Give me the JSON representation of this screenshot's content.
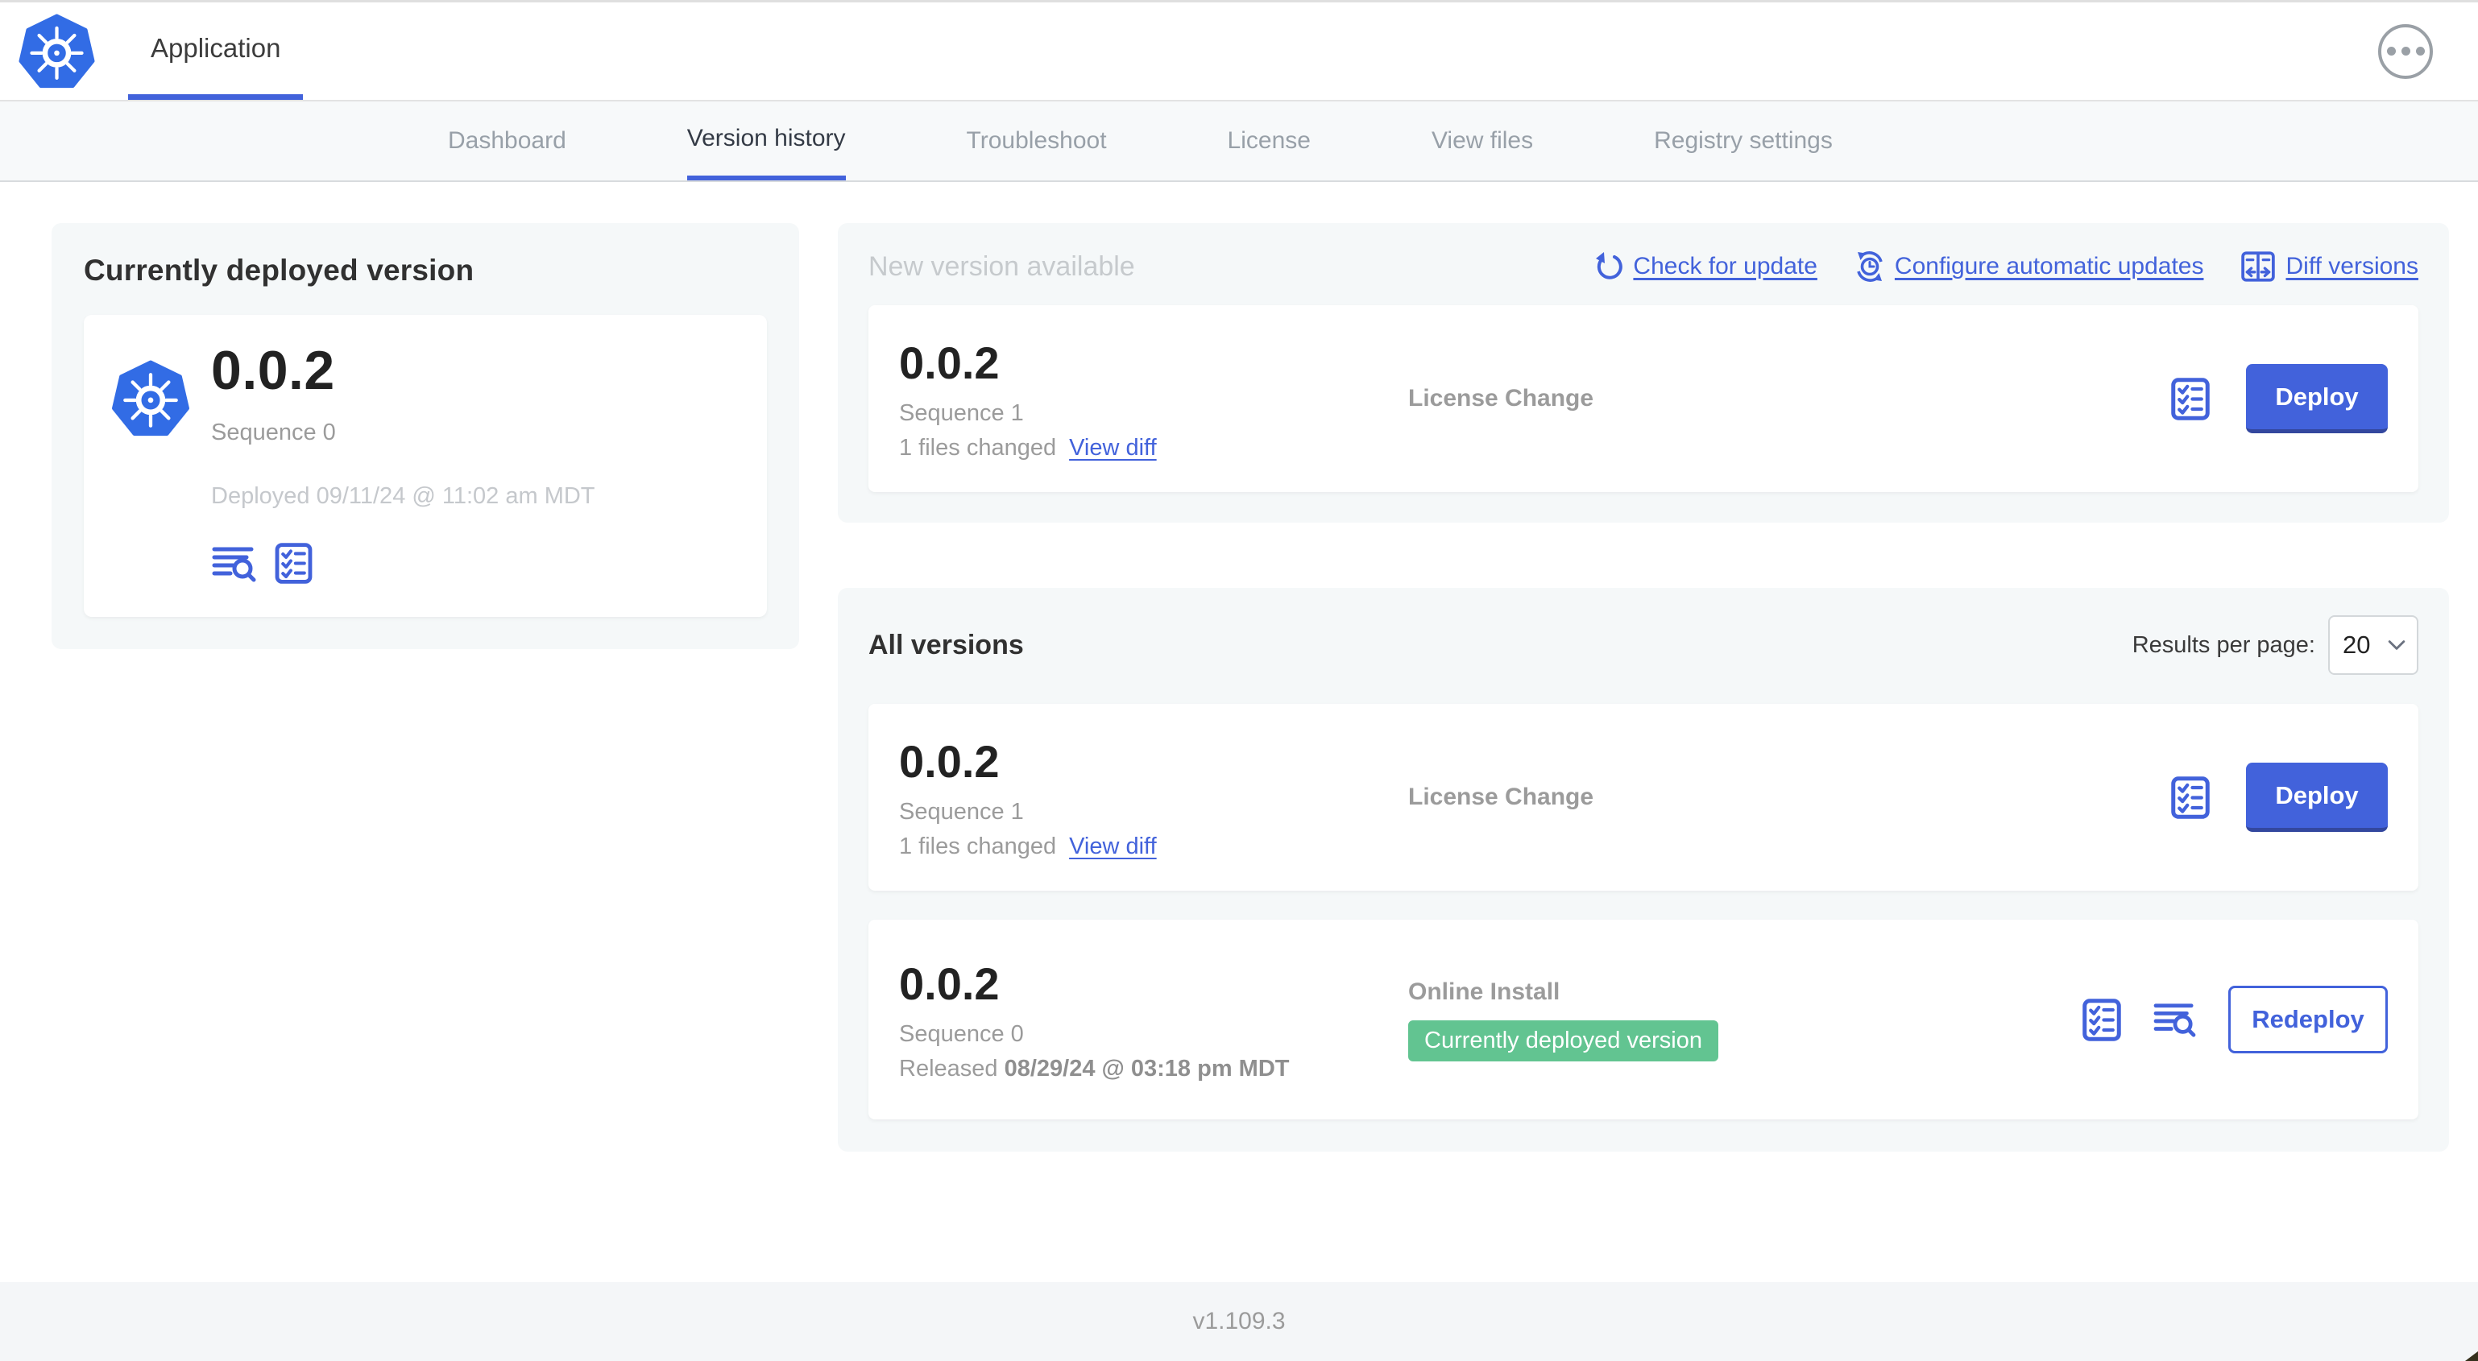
{
  "header": {
    "app_tab_label": "Application"
  },
  "nav_tabs": [
    "Dashboard",
    "Version history",
    "Troubleshoot",
    "License",
    "View files",
    "Registry settings"
  ],
  "current_version": {
    "title": "Currently deployed version",
    "version": "0.0.2",
    "sequence": "Sequence 0",
    "deployed_at": "Deployed 09/11/24 @ 11:02 am MDT"
  },
  "new_version": {
    "title": "New version available",
    "check_for_update": "Check for update",
    "configure_auto_updates": "Configure automatic updates",
    "diff_versions": "Diff versions",
    "row": {
      "version": "0.0.2",
      "sequence": "Sequence 1",
      "files_changed": "1 files changed",
      "view_diff": "View diff",
      "source": "License Change",
      "action": "Deploy"
    }
  },
  "all_versions": {
    "title": "All versions",
    "results_per_page_label": "Results per page:",
    "results_per_page": "20",
    "rows": [
      {
        "version": "0.0.2",
        "sequence": "Sequence 1",
        "files_changed": "1 files changed",
        "view_diff": "View diff",
        "source": "License Change",
        "action": "Deploy"
      },
      {
        "version": "0.0.2",
        "sequence": "Sequence 0",
        "released_prefix": "Released",
        "released_at": "08/29/24 @ 03:18 pm MDT",
        "source": "Online Install",
        "badge": "Currently deployed version",
        "action": "Redeploy"
      }
    ]
  },
  "footer": {
    "app_version": "v1.109.3"
  },
  "colors": {
    "accent_blue": "#4262db",
    "kubernetes_blue": "#326ce5",
    "badge_green": "#62c491",
    "section_bg": "#f5f8f9",
    "muted_text": "#9b9b9b"
  }
}
